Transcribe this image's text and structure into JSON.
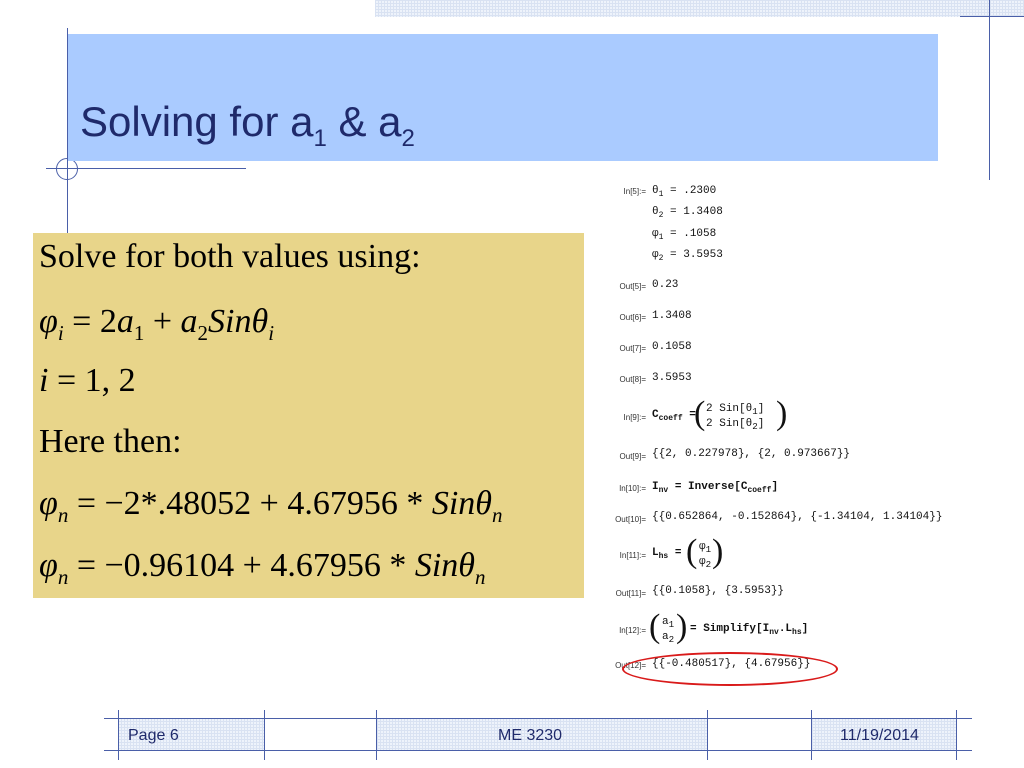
{
  "slide": {
    "title_text": "Solving for a",
    "title_sub1": "1",
    "title_amp": "& a",
    "title_sub2": "2"
  },
  "equations": {
    "line1": "Solve for both values using:",
    "line2": "φ_i = 2a_1 + a_2 Sinθ_i",
    "line3": "i = 1, 2",
    "line4": "Here then:",
    "line5": "φ_n = −2*.48052 + 4.67956*Sinθ_n",
    "line6": "φ_n = −0.96104 + 4.67956*Sinθ_n"
  },
  "notebook": {
    "in5_label": "In[5]:=",
    "theta1": "= .2300",
    "theta2": "= 1.3408",
    "phi1": "= .1058",
    "phi2": "= 3.5953",
    "out5_label": "Out[5]=",
    "out5": "0.23",
    "out6_label": "Out[6]=",
    "out6": "1.3408",
    "out7_label": "Out[7]=",
    "out7": "0.1058",
    "out8_label": "Out[8]=",
    "out8": "3.5953",
    "in9_label": "In[9]:=",
    "in9_lhs": "C",
    "in9_lhs_sub": "coeff",
    "in9_eq": "=",
    "m_r1c1": "2",
    "m_r1c2": "Sin[θ",
    "m_r1c2_sub": "1",
    "m_r1c2_end": "]",
    "m_r2c1": "2",
    "m_r2c2": "Sin[θ",
    "m_r2c2_sub": "2",
    "m_r2c2_end": "]",
    "out9_label": "Out[9]=",
    "out9": "{{2, 0.227978}, {2, 0.973667}}",
    "in10_label": "In[10]:=",
    "in10_lhs": "I",
    "in10_lhs_sub": "nv",
    "in10_rhs": "= Inverse[C",
    "in10_rhs_sub": "coeff",
    "in10_rhs_end": "]",
    "out10_label": "Out[10]=",
    "out10": "{{0.652864, -0.152864}, {-1.34104, 1.34104}}",
    "in11_label": "In[11]:=",
    "in11_lhs": "L",
    "in11_lhs_sub": "hs",
    "in11_eq": "=",
    "v11_r1": "φ",
    "v11_r1_sub": "1",
    "v11_r2": "φ",
    "v11_r2_sub": "2",
    "out11_label": "Out[11]=",
    "out11": "{{0.1058}, {3.5953}}",
    "in12_label": "In[12]:=",
    "v12_r1": "a",
    "v12_r1_sub": "1",
    "v12_r2": "a",
    "v12_r2_sub": "2",
    "in12_rhs": "= Simplify[I",
    "in12_rhs_sub1": "nv",
    "in12_rhs_mid": ".L",
    "in12_rhs_sub2": "hs",
    "in12_rhs_end": "]",
    "out12_label": "Out[12]=",
    "out12": "{{-0.480517}, {4.67956}}"
  },
  "footer": {
    "page": "Page 6",
    "course": "ME 3230",
    "date": "11/19/2014"
  },
  "colors": {
    "title_band": "#aacbff",
    "title_text": "#1f2a6b",
    "equation_box": "#e8d58a",
    "highlight_ellipse": "#d91a1a"
  }
}
